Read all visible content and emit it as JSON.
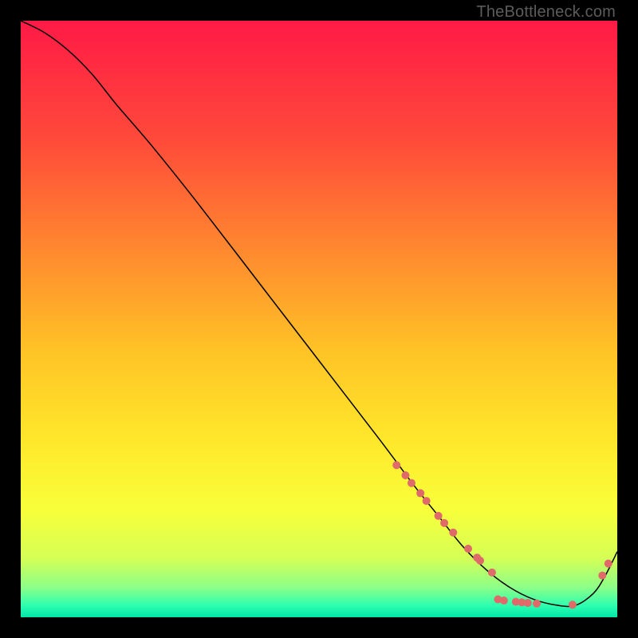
{
  "watermark": "TheBottleneck.com",
  "chart_data": {
    "type": "line",
    "title": "",
    "xlabel": "",
    "ylabel": "",
    "xlim": [
      0,
      100
    ],
    "ylim": [
      0,
      100
    ],
    "grid": false,
    "legend": false,
    "background_gradient": {
      "type": "vertical",
      "stops": [
        {
          "offset": 0.0,
          "color": "#ff1a46"
        },
        {
          "offset": 0.2,
          "color": "#ff4a3a"
        },
        {
          "offset": 0.4,
          "color": "#ff8e2e"
        },
        {
          "offset": 0.55,
          "color": "#ffc226"
        },
        {
          "offset": 0.7,
          "color": "#ffe72a"
        },
        {
          "offset": 0.82,
          "color": "#f8ff3a"
        },
        {
          "offset": 0.9,
          "color": "#d6ff55"
        },
        {
          "offset": 0.95,
          "color": "#8dff88"
        },
        {
          "offset": 0.98,
          "color": "#2effb0"
        },
        {
          "offset": 1.0,
          "color": "#00e6a8"
        }
      ]
    },
    "series": [
      {
        "name": "curve",
        "type": "line",
        "color": "#000000",
        "width": 1.5,
        "x": [
          0,
          4,
          8,
          12,
          16,
          22,
          30,
          40,
          50,
          60,
          66,
          70,
          74,
          78,
          82,
          86,
          90,
          93,
          96,
          98,
          100
        ],
        "y": [
          100,
          98,
          95,
          91,
          86,
          79,
          69,
          56,
          43,
          30,
          22,
          17,
          12,
          8,
          5,
          3,
          2,
          2,
          4,
          7,
          11
        ]
      },
      {
        "name": "markers",
        "type": "scatter",
        "color": "#e06a6a",
        "radius": 5,
        "x": [
          63,
          64.5,
          65.5,
          67,
          68,
          70,
          71,
          72.5,
          75,
          76.5,
          77,
          79,
          80,
          81,
          83,
          84,
          85,
          86.5,
          92.5,
          97.5,
          98.5
        ],
        "y": [
          25.5,
          23.8,
          22.5,
          20.8,
          19.5,
          17.0,
          15.8,
          14.2,
          11.5,
          10.0,
          9.5,
          7.5,
          3.0,
          2.8,
          2.6,
          2.5,
          2.4,
          2.3,
          2.1,
          7.0,
          9.0
        ]
      }
    ]
  }
}
